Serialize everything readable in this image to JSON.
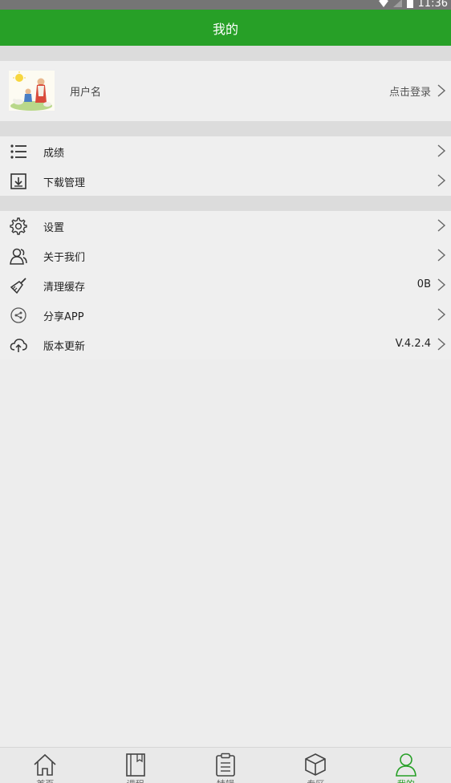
{
  "status_bar": {
    "time": "11:36"
  },
  "header": {
    "title": "我的"
  },
  "profile": {
    "username": "用户名",
    "login_label": "点击登录"
  },
  "menu_group_1": [
    {
      "label": "成绩",
      "icon": "list-icon"
    },
    {
      "label": "下载管理",
      "icon": "download-icon"
    }
  ],
  "menu_group_2": [
    {
      "label": "设置",
      "icon": "gear-icon",
      "value": ""
    },
    {
      "label": "关于我们",
      "icon": "people-icon",
      "value": ""
    },
    {
      "label": "清理缓存",
      "icon": "brush-icon",
      "value": "0B"
    },
    {
      "label": "分享APP",
      "icon": "share-icon",
      "value": ""
    },
    {
      "label": "版本更新",
      "icon": "cloud-upload-icon",
      "value": "V.4.2.4"
    }
  ],
  "bottom_nav": [
    {
      "label": "首页",
      "icon": "home-icon",
      "active": false
    },
    {
      "label": "课程",
      "icon": "book-icon",
      "active": false
    },
    {
      "label": "特辑",
      "icon": "clipboard-icon",
      "active": false
    },
    {
      "label": "专区",
      "icon": "cube-icon",
      "active": false
    },
    {
      "label": "我的",
      "icon": "user-icon",
      "active": true
    }
  ],
  "colors": {
    "accent": "#27a027",
    "background": "#ededed",
    "row_background": "#efefef",
    "separator": "#dcdcdc"
  }
}
